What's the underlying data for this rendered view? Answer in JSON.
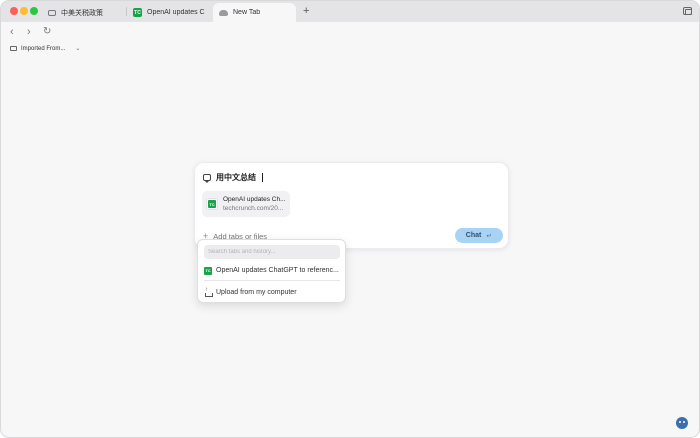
{
  "tabs": [
    {
      "label": "中美关税政策",
      "icon": "chat-bubble-icon"
    },
    {
      "label": "OpenAI updates ChatG",
      "icon": "techcrunch-icon"
    },
    {
      "label": "New Tab",
      "icon": "cloud-icon",
      "active": true
    }
  ],
  "new_tab_symbol": "+",
  "nav": {
    "back": "‹",
    "forward": "›",
    "reload": "↻"
  },
  "bookmarks": [
    {
      "label": "Imported From...",
      "icon": "folder-icon"
    }
  ],
  "chat_card": {
    "prompt": "用中文总结",
    "attachment": {
      "title": "OpenAI updates Ch...",
      "url": "techcrunch.com/20...",
      "favicon_text": "TC"
    },
    "add_tabs_label": "Add tabs or files",
    "chat_button_label": "Chat",
    "chat_button_enter": "↵"
  },
  "dropdown": {
    "search_placeholder": "Search tabs and history...",
    "items": [
      {
        "label": "OpenAI updates ChatGPT to referenc...",
        "icon": "techcrunch-icon",
        "favicon_text": "TC"
      },
      {
        "label": "Upload from my computer",
        "icon": "upload-icon"
      }
    ]
  },
  "colors": {
    "accent_button": "#a9d3f5",
    "techcrunch_green": "#16a34a",
    "assistant_fab": "#3d6fa8"
  }
}
